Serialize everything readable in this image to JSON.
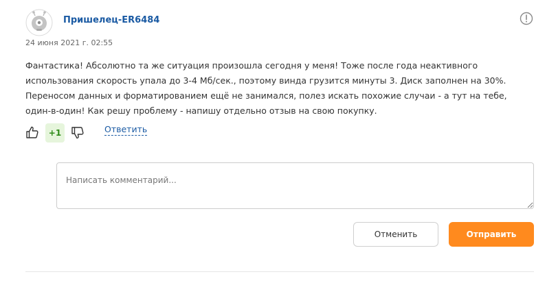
{
  "review": {
    "author": "Пришелец-ER6484",
    "date": "24 июня 2021 г. 02:55",
    "text": "Фантастика! Абсолютно та же ситуация произошла сегодня у меня! Тоже после года неактивного использования скорость упала до 3-4 Мб/сек., поэтому винда грузится минуты 3. Диск заполнен на 30%. Переносом данных и форматированием ещё не занимался, полез искать похожие случаи - а тут на тебе, один-в-один! Как решу проблему - напишу отдельно отзыв на свою покупку.",
    "avatar_icon": "alien-avatar-icon",
    "report_icon": "exclamation-circle-icon"
  },
  "votes": {
    "score": "+1",
    "up_icon": "thumbs-up-icon",
    "down_icon": "thumbs-down-icon",
    "score_color": "#2e8b18",
    "score_bg": "#e6f5dc"
  },
  "reply_link": "Ответить",
  "comment_form": {
    "placeholder": "Написать комментарий...",
    "value": "",
    "cancel_label": "Отменить",
    "submit_label": "Отправить",
    "submit_color": "#ff8a1e"
  },
  "colors": {
    "link": "#1a5aa3",
    "text": "#333333"
  }
}
